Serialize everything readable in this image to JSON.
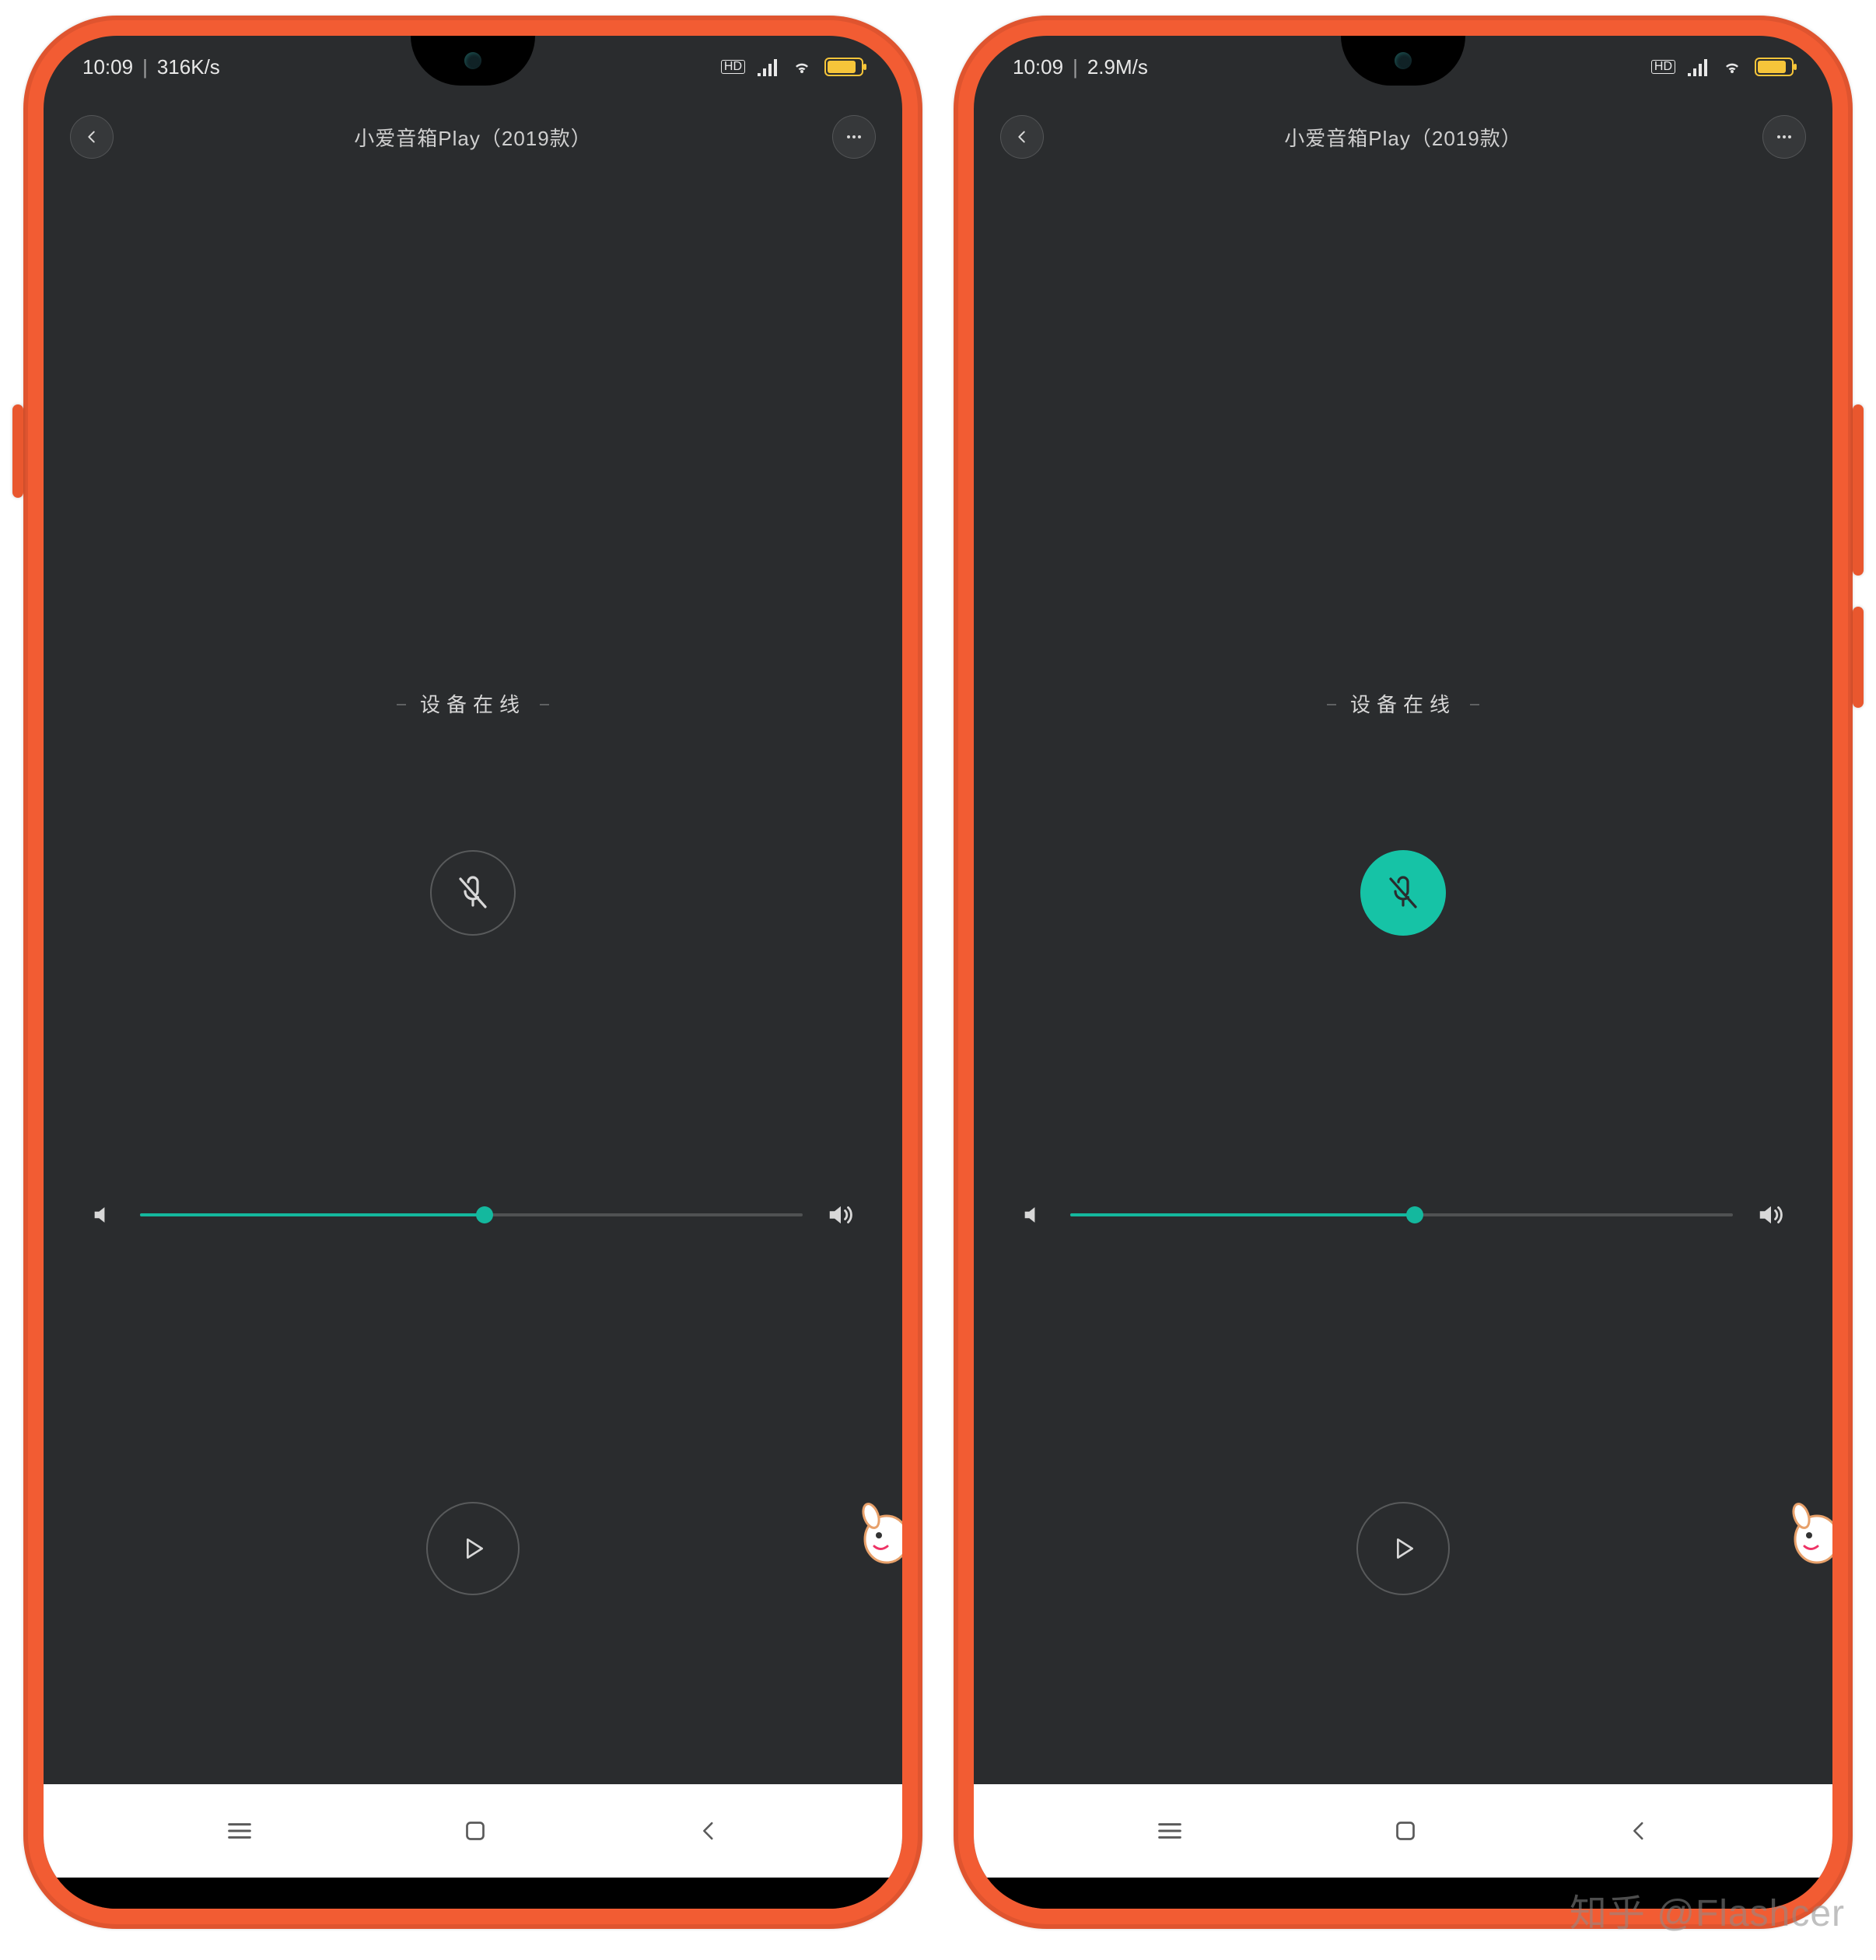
{
  "phones": [
    {
      "status": {
        "time": "10:09",
        "net_speed": "316K/s"
      },
      "title": "小爱音箱Play（2019款）",
      "online_label": "设备在线",
      "mic_active": false,
      "volume_percent": 52
    },
    {
      "status": {
        "time": "10:09",
        "net_speed": "2.9M/s"
      },
      "title": "小爱音箱Play（2019款）",
      "online_label": "设备在线",
      "mic_active": true,
      "volume_percent": 52
    }
  ],
  "colors": {
    "frame": "#f25c33",
    "screen_bg": "#2a2c2e",
    "accent": "#16c3a6",
    "battery": "#f6c53a"
  },
  "watermark": "知乎 @Flashcer"
}
